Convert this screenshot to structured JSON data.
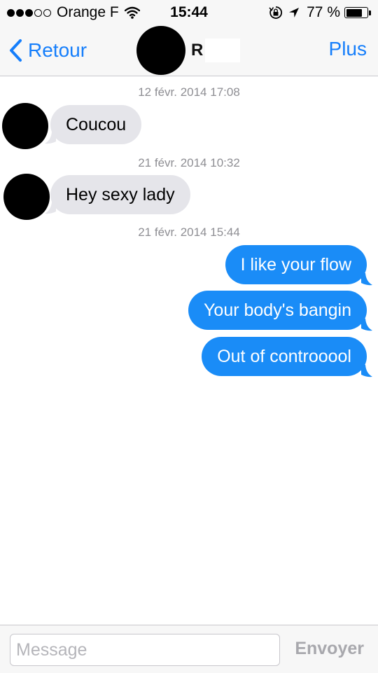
{
  "status_bar": {
    "carrier": "Orange F",
    "signal_bars_filled": 3,
    "signal_bars_total": 5,
    "time": "15:44",
    "battery_label": "77 %",
    "battery_level": 0.77,
    "icons": [
      "wifi-icon",
      "rotation-lock-icon",
      "location-arrow-icon",
      "battery-icon"
    ]
  },
  "nav": {
    "back_label": "Retour",
    "contact_initial": "R",
    "more_label": "Plus",
    "accent_color": "#157efb"
  },
  "conversation": {
    "timestamps": [
      "12 févr. 2014 17:08",
      "21 févr. 2014 10:32",
      "21 févr. 2014 15:44"
    ],
    "incoming": [
      "Coucou",
      "Hey sexy lady"
    ],
    "outgoing": [
      "I like your flow",
      "Your body's bangin",
      "Out of controoool"
    ],
    "incoming_color": "#e5e5ea",
    "outgoing_color": "#1a8cf7"
  },
  "compose": {
    "placeholder": "Message",
    "send_label": "Envoyer"
  }
}
